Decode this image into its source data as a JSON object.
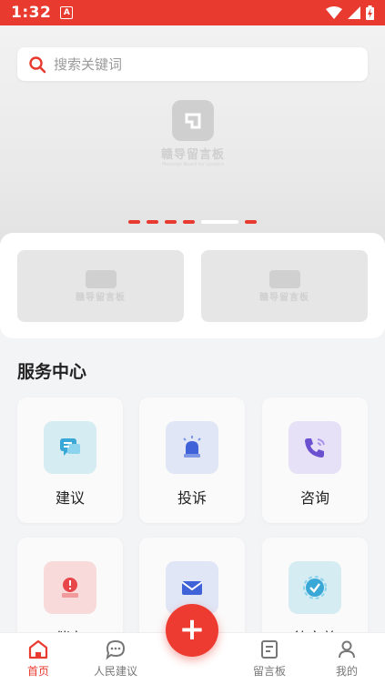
{
  "status": {
    "time": "1:32",
    "notif_icon": "A"
  },
  "search": {
    "placeholder": "搜索关键词"
  },
  "banner": {
    "logo_text": "赣导留言板",
    "logo_sub": "Message Board for Leaders"
  },
  "thumbs": [
    {
      "logo_text": "赣导留言板"
    },
    {
      "logo_text": "赣导留言板"
    }
  ],
  "section": {
    "title": "服务中心"
  },
  "services": [
    {
      "label": "建议",
      "icon": "chat-bubble-icon"
    },
    {
      "label": "投诉",
      "icon": "alarm-light-icon"
    },
    {
      "label": "咨询",
      "icon": "phone-icon"
    },
    {
      "label": "催办",
      "icon": "urge-icon"
    },
    {
      "label": "中转办",
      "icon": "mail-icon"
    },
    {
      "label": "待完善",
      "icon": "check-badge-icon"
    }
  ],
  "tabs": [
    {
      "label": "首页",
      "icon": "home-icon"
    },
    {
      "label": "人民建议",
      "icon": "message-icon"
    },
    {
      "label": "留言板",
      "icon": "board-icon"
    },
    {
      "label": "我的",
      "icon": "user-icon"
    }
  ],
  "fab": {
    "label": "+"
  },
  "colors": {
    "brand": "#e83a2f",
    "background": "#f3f4f6"
  }
}
